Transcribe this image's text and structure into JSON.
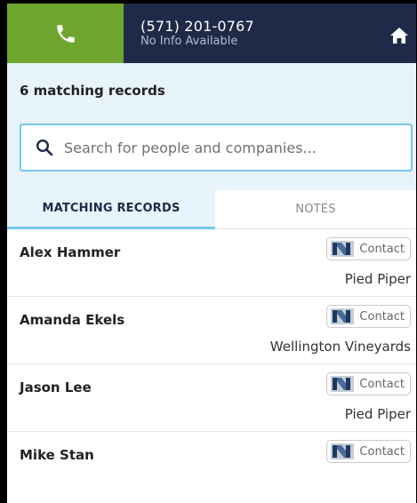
{
  "caller": {
    "number": "(571) 201-0767",
    "info": "No Info Available"
  },
  "icons": {
    "call": "phone-icon",
    "home": "home-icon",
    "search": "search-icon",
    "contact_logo": "nutshell-logo-icon"
  },
  "colors": {
    "header": "#1f2a48",
    "call_button": "#6ea52f",
    "info_band": "#e8f4fb",
    "accent": "#74c6e8"
  },
  "summary": {
    "match_count": "6 matching records"
  },
  "search": {
    "placeholder": "Search for people and companies..."
  },
  "tabs": [
    {
      "label": "MATCHING RECORDS",
      "active": true
    },
    {
      "label": "NOTES",
      "active": false
    }
  ],
  "records": [
    {
      "name": "Alex Hammer",
      "badge": "Contact",
      "company": "Pied Piper"
    },
    {
      "name": "Amanda Ekels",
      "badge": "Contact",
      "company": "Wellington Vineyards"
    },
    {
      "name": "Jason Lee",
      "badge": "Contact",
      "company": "Pied Piper"
    },
    {
      "name": "Mike Stan",
      "badge": "Contact",
      "company": ""
    }
  ]
}
